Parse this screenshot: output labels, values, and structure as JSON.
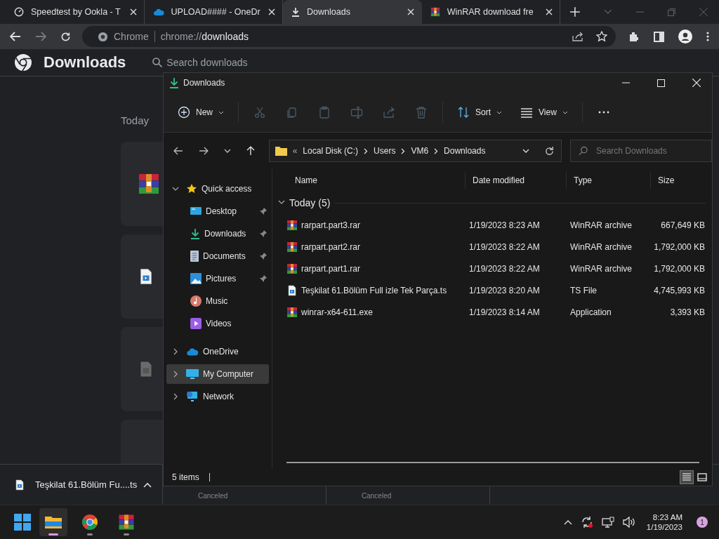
{
  "browser": {
    "tabs": [
      {
        "title": "Speedtest by Ookla - T",
        "kind": "speed",
        "selected": false
      },
      {
        "title": "UPLOAD#### - OneDr",
        "kind": "cloud",
        "selected": false
      },
      {
        "title": "Downloads",
        "kind": "download",
        "selected": true
      },
      {
        "title": "WinRAR download fre",
        "kind": "archive",
        "selected": false
      }
    ],
    "site_label": "Chrome",
    "url_dim": "chrome://",
    "url_main": "downloads"
  },
  "downloads_page": {
    "title": "Downloads",
    "search": {
      "placeholder": "Search downloads"
    },
    "section": "Today",
    "cards": [
      {
        "kind": "archive"
      },
      {
        "kind": "video"
      },
      {
        "kind": "file"
      },
      {
        "kind": "blank"
      }
    ]
  },
  "explorer": {
    "title": "Downloads",
    "toolbar": [
      {
        "kind": "new",
        "label": "New",
        "disabled": false
      },
      {
        "kind": "cut",
        "disabled": true
      },
      {
        "kind": "copy",
        "disabled": true
      },
      {
        "kind": "paste",
        "disabled": true
      },
      {
        "kind": "rename",
        "disabled": true
      },
      {
        "kind": "share",
        "disabled": true
      },
      {
        "kind": "delete",
        "disabled": true
      },
      {
        "kind": "sort",
        "label": "Sort",
        "disabled": false
      },
      {
        "kind": "view",
        "label": "View",
        "disabled": false
      },
      {
        "kind": "more",
        "disabled": false
      }
    ],
    "path_overflow": "«",
    "path": [
      "Local Disk (C:)",
      "Users",
      "VM6",
      "Downloads"
    ],
    "search": {
      "placeholder": "Search Downloads"
    },
    "sidebar": [
      {
        "label": "Quick access",
        "kind": "star",
        "expanded": true,
        "selected": false,
        "children": [
          {
            "label": "Desktop",
            "kind": "desktop",
            "pinned": true,
            "selected": false
          },
          {
            "label": "Downloads",
            "kind": "download",
            "pinned": true,
            "selected": false
          },
          {
            "label": "Documents",
            "kind": "document",
            "pinned": true,
            "selected": false
          },
          {
            "label": "Pictures",
            "kind": "pictures",
            "pinned": true,
            "selected": false
          },
          {
            "label": "Music",
            "kind": "music",
            "pinned": false,
            "selected": false
          },
          {
            "label": "Videos",
            "kind": "videos",
            "pinned": false,
            "selected": false
          }
        ]
      },
      {
        "label": "OneDrive",
        "kind": "cloud",
        "expanded": false,
        "selected": false
      },
      {
        "label": "My Computer",
        "kind": "computer",
        "expanded": false,
        "selected": true
      },
      {
        "label": "Network",
        "kind": "network",
        "expanded": false,
        "selected": false
      }
    ],
    "columns": [
      "Name",
      "Date modified",
      "Type",
      "Size"
    ],
    "group": {
      "label": "Today (5)",
      "expanded": true
    },
    "rows": [
      {
        "name": "rarpart.part3.rar",
        "date": "1/19/2023 8:23 AM",
        "type": "WinRAR archive",
        "size": "667,649 KB",
        "kind": "archive"
      },
      {
        "name": "rarpart.part2.rar",
        "date": "1/19/2023 8:22 AM",
        "type": "WinRAR archive",
        "size": "1,792,000 KB",
        "kind": "archive"
      },
      {
        "name": "rarpart.part1.rar",
        "date": "1/19/2023 8:22 AM",
        "type": "WinRAR archive",
        "size": "1,792,000 KB",
        "kind": "archive"
      },
      {
        "name": "Teşkilat 61.Bölüm Full izle Tek Parça.ts",
        "date": "1/19/2023 8:20 AM",
        "type": "TS File",
        "size": "4,745,993 KB",
        "kind": "video"
      },
      {
        "name": "winrar-x64-611.exe",
        "date": "1/19/2023 8:14 AM",
        "type": "Application",
        "size": "3,393 KB",
        "kind": "archive"
      }
    ],
    "status": "5 items",
    "views": [
      {
        "kind": "details",
        "selected": true
      },
      {
        "kind": "tiles",
        "selected": false
      }
    ]
  },
  "shelf": {
    "items": [
      {
        "name": "Teşkilat 61.Bölüm Fu....ts",
        "kind": "video"
      }
    ],
    "canceled": [
      "Canceled",
      "Canceled"
    ]
  },
  "taskbar": {
    "apps": [
      {
        "kind": "explorer",
        "active": true
      },
      {
        "kind": "browser",
        "active": false
      },
      {
        "kind": "archive",
        "active": false
      }
    ],
    "time": "8:23 AM",
    "date": "1/19/2023",
    "badge": "1"
  }
}
